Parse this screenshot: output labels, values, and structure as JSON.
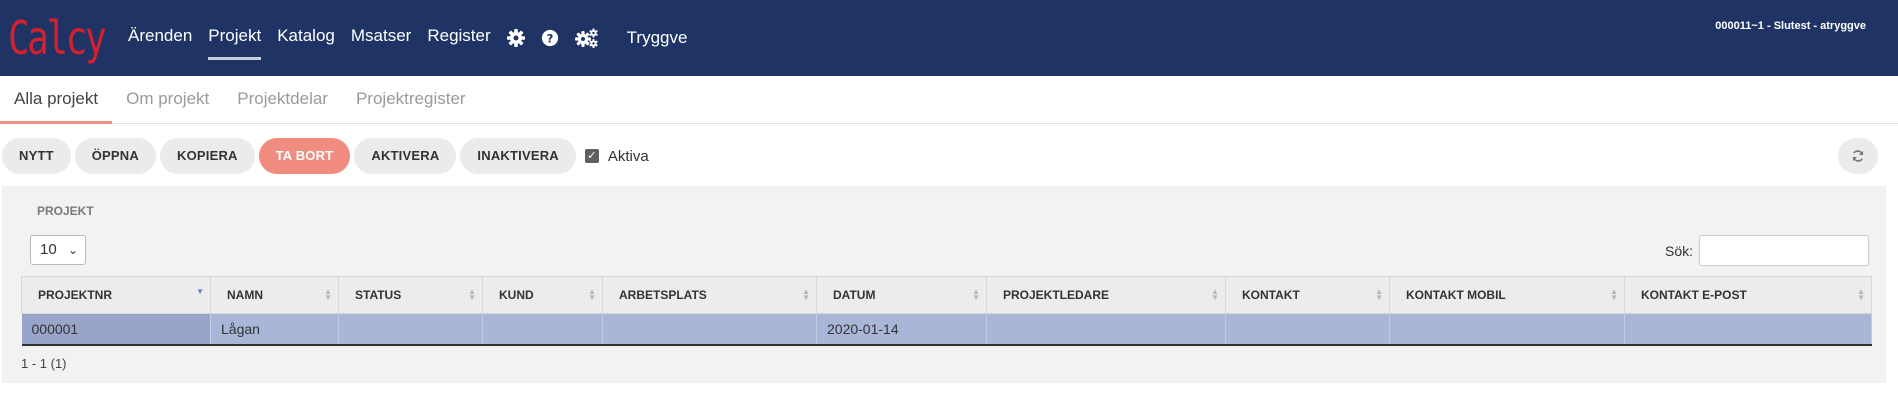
{
  "app": {
    "logo": "Calcy"
  },
  "nav": {
    "items": [
      "Ärenden",
      "Projekt",
      "Katalog",
      "Msatser",
      "Register"
    ],
    "active": "Projekt",
    "icons": [
      "gear-icon",
      "help-icon",
      "gears-icon"
    ],
    "user": "Tryggve"
  },
  "session": {
    "info": "000011~1 - Slutest - atryggve"
  },
  "tabs": [
    "Alla projekt",
    "Om projekt",
    "Projektdelar",
    "Projektregister"
  ],
  "toolbar": {
    "buttons": [
      "NYTT",
      "ÖPPNA",
      "KOPIERA",
      "TA BORT",
      "AKTIVERA",
      "INAKTIVERA"
    ],
    "active_checkbox_label": "Aktiva",
    "active_checked": true,
    "danger_color": "#f08c80"
  },
  "panel": {
    "title": "PROJEKT",
    "page_size": "10",
    "search_label": "Sök:",
    "search_value": ""
  },
  "table": {
    "columns": [
      "PROJEKTNR",
      "NAMN",
      "STATUS",
      "KUND",
      "ARBETSPLATS",
      "DATUM",
      "PROJEKTLEDARE",
      "KONTAKT",
      "KONTAKT MOBIL",
      "KONTAKT E-POST"
    ],
    "sorted_column": "PROJEKTNR",
    "rows": [
      [
        "000001",
        "Lågan",
        "",
        "",
        "",
        "2020-01-14",
        "",
        "",
        "",
        ""
      ]
    ]
  },
  "footer": {
    "count": "1 - 1 (1)"
  },
  "colors": {
    "topbar": "#1f3464",
    "logo": "#d4202f",
    "selected_row": "#aab6d8",
    "tab_underline": "#f08e86"
  }
}
